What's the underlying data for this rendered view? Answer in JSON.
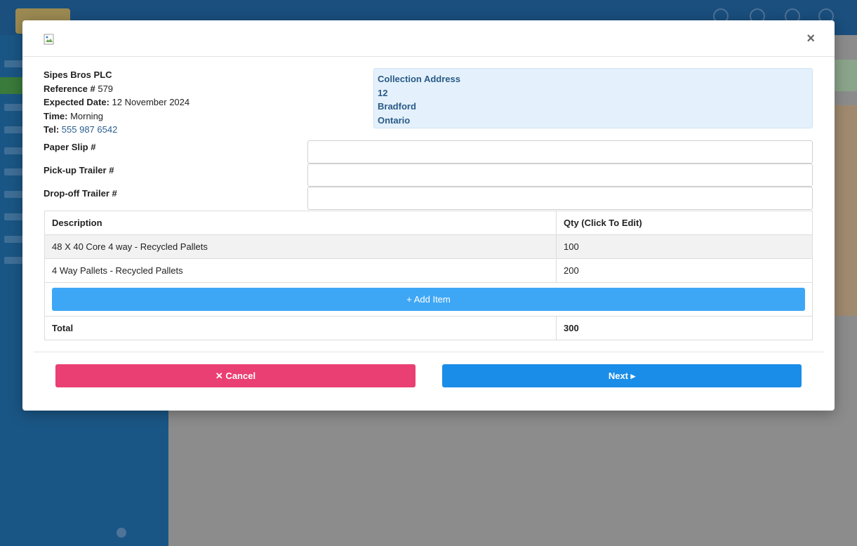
{
  "modal": {
    "close_glyph": "×",
    "customer": {
      "company": "Sipes Bros PLC",
      "reference_label": "Reference #",
      "reference_value": "579",
      "expected_date_label": "Expected Date:",
      "expected_date_value": "12 November 2024",
      "time_label": "Time:",
      "time_value": "Morning",
      "tel_label": "Tel:",
      "tel_value": "555 987 6542"
    },
    "collection_address": {
      "heading": "Collection Address",
      "line1": "12",
      "line2": "Bradford",
      "line3": "Ontario"
    },
    "fields": {
      "paper_slip": {
        "label": "Paper Slip #",
        "value": ""
      },
      "pickup_trailer": {
        "label": "Pick-up Trailer #",
        "value": ""
      },
      "dropoff_trailer": {
        "label": "Drop-off Trailer #",
        "value": ""
      }
    },
    "table": {
      "headers": [
        "Description",
        "Qty (Click To Edit)"
      ],
      "rows": [
        {
          "description": "48 X 40 Core 4 way - Recycled Pallets",
          "qty": "100"
        },
        {
          "description": "4 Way Pallets - Recycled Pallets",
          "qty": "200"
        }
      ],
      "add_item_label": "+ Add Item",
      "total_label": "Total",
      "total_value": "300"
    },
    "buttons": {
      "cancel": "✕ Cancel",
      "next": "Next ▸"
    }
  },
  "colors": {
    "cancel": "#ea3f73",
    "next": "#1a8de8",
    "add_item": "#3ea7f5",
    "address_bg": "#e4f1fc"
  }
}
